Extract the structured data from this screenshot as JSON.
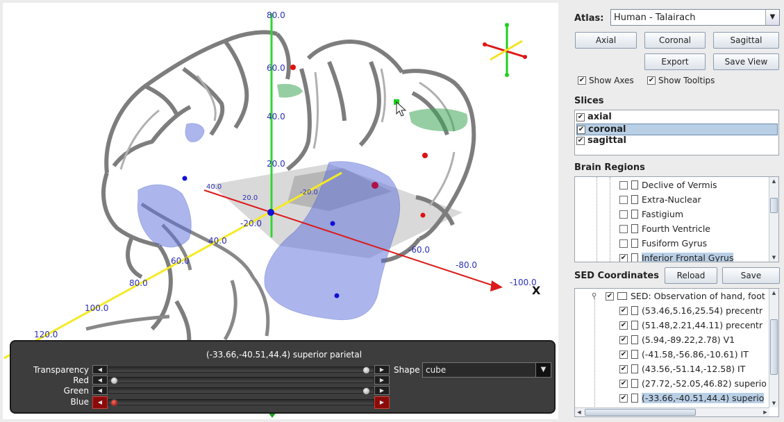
{
  "viewport": {
    "axis_labels": {
      "z": [
        "80.0",
        "60.0",
        "40.0",
        "20.0",
        "-20.0"
      ],
      "y": [
        "40.0",
        "20.0",
        "-20.0",
        "-60.0",
        "-80.0",
        "-100.0"
      ],
      "x_axis_name": "X",
      "yellow": [
        "40.0",
        "60.0",
        "80.0",
        "100.0",
        "120.0"
      ]
    },
    "orientation_gizmo": "axes-gizmo-icon"
  },
  "control_panel": {
    "selected_info": "(-33.66,-40.51,44.4) superior parietal",
    "sliders": [
      {
        "label": "Transparency",
        "value": 0.97
      },
      {
        "label": "Red",
        "value": 0.02
      },
      {
        "label": "Green",
        "value": 0.97
      },
      {
        "label": "Blue",
        "value": 0.02
      }
    ],
    "shape_label": "Shape",
    "shape_value": "cube"
  },
  "side": {
    "atlas_label": "Atlas:",
    "atlas_value": "Human - Talairach",
    "buttons": {
      "axial": "Axial",
      "coronal": "Coronal",
      "sagittal": "Sagittal",
      "export": "Export",
      "save_view": "Save View"
    },
    "show_axes": "Show Axes",
    "show_tooltips": "Show Tooltips",
    "slices_label": "Slices",
    "slices": [
      {
        "label": "axial",
        "checked": true,
        "selected": false
      },
      {
        "label": "coronal",
        "checked": true,
        "selected": true
      },
      {
        "label": "sagittal",
        "checked": true,
        "selected": false
      }
    ],
    "brain_regions_label": "Brain Regions",
    "brain_regions": [
      {
        "label": "Declive of Vermis",
        "checked": false,
        "selected": false
      },
      {
        "label": "Extra-Nuclear",
        "checked": false,
        "selected": false
      },
      {
        "label": "Fastigium",
        "checked": false,
        "selected": false
      },
      {
        "label": "Fourth Ventricle",
        "checked": false,
        "selected": false
      },
      {
        "label": "Fusiform Gyrus",
        "checked": false,
        "selected": false
      },
      {
        "label": "Inferior Frontal Gyrus",
        "checked": true,
        "selected": true
      }
    ],
    "sed_label": "SED Coordinates",
    "reload": "Reload",
    "save": "Save",
    "sed_root": "SED: Observation of hand, foot",
    "sed_items": [
      {
        "label": "(53.46,5.16,25.54) precentr",
        "checked": true,
        "selected": false
      },
      {
        "label": "(51.48,2.21,44.11) precentr",
        "checked": true,
        "selected": false
      },
      {
        "label": "(5.94,-89.22,2.78) V1",
        "checked": true,
        "selected": false
      },
      {
        "label": "(-41.58,-56.86,-10.61) IT",
        "checked": true,
        "selected": false
      },
      {
        "label": "(43.56,-51.14,-12.58) IT",
        "checked": true,
        "selected": false
      },
      {
        "label": "(27.72,-52.05,46.82) superio",
        "checked": true,
        "selected": false
      },
      {
        "label": "(-33.66,-40.51,44.4) superio",
        "checked": true,
        "selected": true
      }
    ]
  }
}
